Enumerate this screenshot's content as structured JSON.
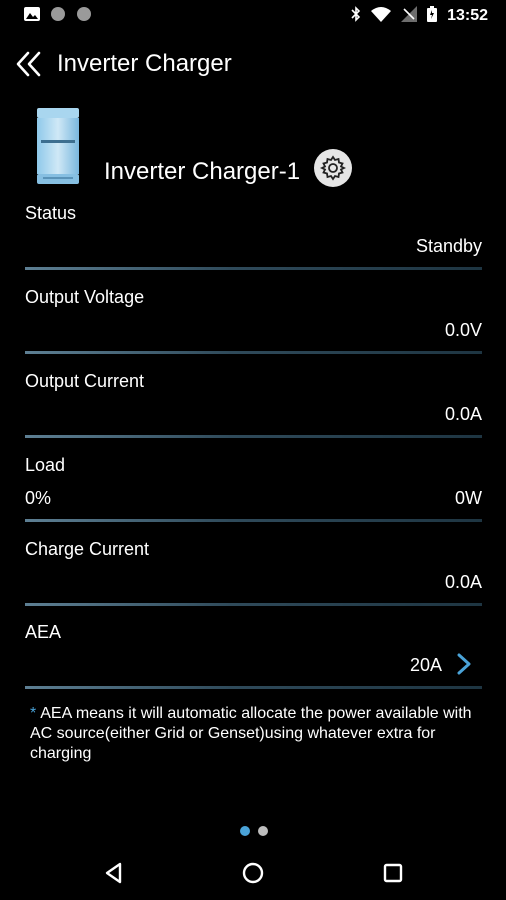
{
  "status_bar": {
    "time": "13:52",
    "icons": [
      "image-icon",
      "circle-icon",
      "circle-icon",
      "bluetooth-icon",
      "wifi-icon",
      "no-signal-icon",
      "battery-icon"
    ]
  },
  "app_bar": {
    "title": "Inverter Charger",
    "back_icon": "double-chevron-left-icon"
  },
  "device": {
    "name": "Inverter Charger-1",
    "settings_icon": "gear-icon"
  },
  "rows": [
    {
      "label": "Status",
      "value": "Standby"
    },
    {
      "label": "Output Voltage",
      "value": "0.0V"
    },
    {
      "label": "Output Current",
      "value": "0.0A"
    },
    {
      "label": "Load",
      "value_left": "0%",
      "value": "0W"
    },
    {
      "label": "Charge Current",
      "value": "0.0A"
    },
    {
      "label": "AEA",
      "value": "20A"
    }
  ],
  "note": {
    "star": "*",
    "text": "AEA means it will automatic allocate the power available with AC source(either Grid or Genset)using whatever extra for charging"
  },
  "pager": {
    "active_index": 0,
    "count": 2
  },
  "colors": {
    "accent": "#4aa3d8",
    "divider": "#4d6e82",
    "background": "#000000"
  }
}
